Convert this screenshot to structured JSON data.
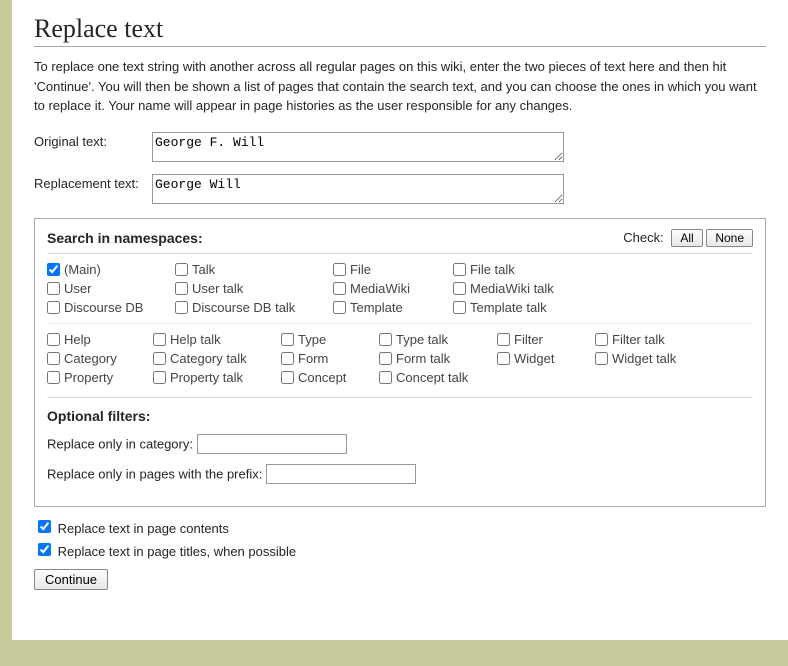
{
  "title": "Replace text",
  "intro": "To replace one text string with another across all regular pages on this wiki, enter the two pieces of text here and then hit 'Continue'. You will then be shown a list of pages that contain the search text, and you can choose the ones in which you want to replace it. Your name will appear in page histories as the user responsible for any changes.",
  "labels": {
    "original": "Original text:",
    "replacement": "Replacement text:",
    "searchIn": "Search in namespaces:",
    "check": "Check:",
    "all": "All",
    "none": "None",
    "optional": "Optional filters:",
    "onlyCategory": "Replace only in category:",
    "onlyPrefix": "Replace only in pages with the prefix:",
    "replaceContents": "Replace text in page contents",
    "replaceTitles": "Replace text in page titles, when possible",
    "continue": "Continue"
  },
  "values": {
    "original": "George F. Will",
    "replacement": "George Will",
    "category": "",
    "prefix": "",
    "replaceContents": true,
    "replaceTitles": true
  },
  "namespacesA": [
    {
      "label": "(Main)",
      "checked": true
    },
    {
      "label": "Talk",
      "checked": false
    },
    {
      "label": "File",
      "checked": false
    },
    {
      "label": "File talk",
      "checked": false
    },
    {
      "label": "User",
      "checked": false
    },
    {
      "label": "User talk",
      "checked": false
    },
    {
      "label": "MediaWiki",
      "checked": false
    },
    {
      "label": "MediaWiki talk",
      "checked": false
    },
    {
      "label": "Discourse DB",
      "checked": false
    },
    {
      "label": "Discourse DB talk",
      "checked": false
    },
    {
      "label": "Template",
      "checked": false
    },
    {
      "label": "Template talk",
      "checked": false
    }
  ],
  "namespacesB": [
    {
      "label": "Help",
      "checked": false
    },
    {
      "label": "Help talk",
      "checked": false
    },
    {
      "label": "Type",
      "checked": false
    },
    {
      "label": "Type talk",
      "checked": false
    },
    {
      "label": "Filter",
      "checked": false
    },
    {
      "label": "Filter talk",
      "checked": false
    },
    {
      "label": "Category",
      "checked": false
    },
    {
      "label": "Category talk",
      "checked": false
    },
    {
      "label": "Form",
      "checked": false
    },
    {
      "label": "Form talk",
      "checked": false
    },
    {
      "label": "Widget",
      "checked": false
    },
    {
      "label": "Widget talk",
      "checked": false
    },
    {
      "label": "Property",
      "checked": false
    },
    {
      "label": "Property talk",
      "checked": false
    },
    {
      "label": "Concept",
      "checked": false
    },
    {
      "label": "Concept talk",
      "checked": false
    }
  ]
}
